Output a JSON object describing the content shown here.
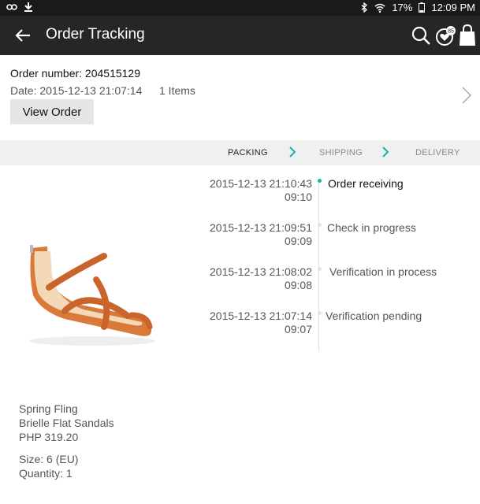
{
  "status_bar": {
    "battery": "17%",
    "time": "12:09 PM"
  },
  "app_bar": {
    "title": "Order Tracking",
    "wishlist_badge": "85"
  },
  "order": {
    "number_label": "Order number: 204515129",
    "date_label": "Date: 2015-12-13 21:07:14",
    "items_label": "1 Items",
    "view_order_label": "View Order"
  },
  "steps": [
    {
      "label": "PACKING",
      "active": true
    },
    {
      "label": "SHIPPING",
      "active": false
    },
    {
      "label": "DELIVERY",
      "active": false
    }
  ],
  "timeline": [
    {
      "date": "2015-12-13 21:10:43",
      "time": "09:10",
      "status": "Order receiving",
      "active": true
    },
    {
      "date": "2015-12-13 21:09:51",
      "time": "09:09",
      "status": "Check in progress",
      "active": false
    },
    {
      "date": "2015-12-13 21:08:02",
      "time": "09:08",
      "status": "Verification in process",
      "active": false
    },
    {
      "date": "2015-12-13 21:07:14",
      "time": "09:07",
      "status": "Verification pending",
      "active": false
    }
  ],
  "product": {
    "brand": "Spring Fling",
    "name": "Brielle Flat Sandals",
    "price": "PHP 319.20",
    "size": "Size: 6 (EU)",
    "quantity": "Quantity: 1"
  },
  "colors": {
    "accent": "#12b5a6",
    "appbar": "#262626",
    "shoe": "#d9793a"
  }
}
